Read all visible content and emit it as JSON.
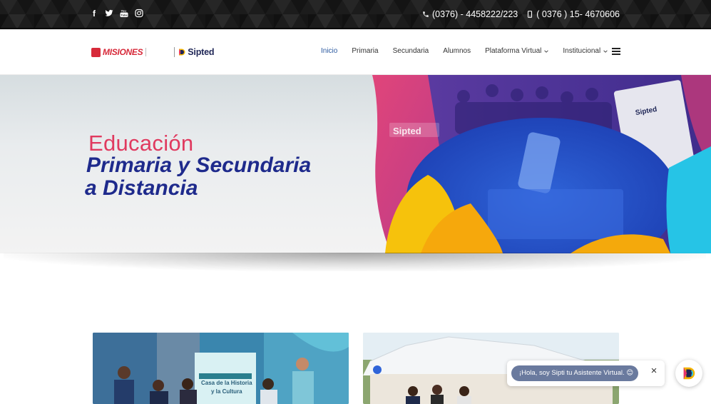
{
  "topbar": {
    "socials": [
      {
        "icon": "facebook-icon",
        "glyph": "f"
      },
      {
        "icon": "twitter-icon",
        "glyph": ""
      },
      {
        "icon": "youtube-icon",
        "glyph": ""
      },
      {
        "icon": "instagram-icon",
        "glyph": ""
      }
    ],
    "phone_landline": "(0376) - 4458222/223",
    "phone_mobile": "( 0376 ) 15- 4670606"
  },
  "header": {
    "logo_misiones": "MISIONES",
    "logo_sipted": "Sipted",
    "nav": [
      {
        "label": "Inicio",
        "active": true,
        "dropdown": false
      },
      {
        "label": "Primaria",
        "active": false,
        "dropdown": false
      },
      {
        "label": "Secundaria",
        "active": false,
        "dropdown": false
      },
      {
        "label": "Alumnos",
        "active": false,
        "dropdown": false
      },
      {
        "label": "Plataforma Virtual",
        "active": false,
        "dropdown": true
      },
      {
        "label": "Institucional",
        "active": false,
        "dropdown": true
      }
    ]
  },
  "hero": {
    "line1": "Educación",
    "line2": "Primaria y Secundaria",
    "line3": "a Distancia",
    "brand_sign": "Sipted"
  },
  "cards": [
    {
      "sign_line1": "Casa de la Historia",
      "sign_line2": "y la Cultura"
    },
    {}
  ],
  "chat": {
    "greeting": "¡Hola, soy Sipti tu Asistente Virtual. 😊",
    "close_label": "×"
  },
  "colors": {
    "accent_blue": "#2c5aa0",
    "headline_blue": "#1e2a8c",
    "headline_pink": "#e03a5f",
    "brand_red": "#d72a3a",
    "topbar_bg": "#1b1b1b"
  }
}
